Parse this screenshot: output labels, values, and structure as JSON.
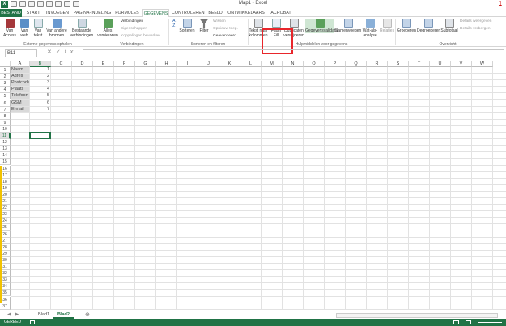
{
  "title": "Map1 - Excel",
  "tabs": [
    "BESTAND",
    "START",
    "INVOEGEN",
    "PAGINA-INDELING",
    "FORMULES",
    "GEGEVENS",
    "CONTROLEREN",
    "BEELD",
    "ONTWIKKELAARS",
    "ACROBAT"
  ],
  "ribbon": {
    "btn_access": "Van\nAccess",
    "btn_web": "Van\nweb",
    "btn_text": "Van\ntekst",
    "btn_other": "Van andere\nbronnen",
    "btn_existing": "Bestaande\nverbindingen",
    "btn_refresh": "Alles\nvernieuwen",
    "conn": "Verbindingen",
    "props": "Eigenschappen",
    "editlinks": "Koppelingen bewerken",
    "btn_sort": "Sorteren",
    "btn_filter": "Filter",
    "clear": "Wissen",
    "reapply": "Opnieuw toep.",
    "advanced": "Geavanceerd",
    "btn_t2c": "Tekst naar\nkolommen",
    "btn_flash": "Flash\nFill",
    "btn_dup": "Duplicaten\nverwijderen",
    "btn_valid": "Gegevensvalidatie",
    "btn_consol": "Samenvoegen",
    "btn_whatif": "Wat-als-\nanalyse",
    "btn_rel": "Relaties",
    "btn_group": "Groeperen",
    "btn_ungroup": "Degroeperen",
    "btn_subtotal": "Subtotaal",
    "showdetail": "Details weergeven",
    "hidedetail": "Details verbergen",
    "g_external": "Externe gegevens ophalen",
    "g_conn": "Verbindingen",
    "g_sort": "Sorteren en filteren",
    "g_tools": "Hulpmiddelen voor gegevens",
    "g_outline": "Overzicht"
  },
  "namebox": "B11",
  "fx_label": "fx",
  "columns": [
    "A",
    "B",
    "C",
    "D",
    "E",
    "F",
    "G",
    "H",
    "I",
    "J",
    "K",
    "L",
    "M",
    "N",
    "O",
    "P",
    "Q",
    "R",
    "S",
    "T",
    "U",
    "V",
    "W"
  ],
  "rows": [
    "1",
    "2",
    "3",
    "4",
    "5",
    "6",
    "7",
    "8",
    "9",
    "10",
    "11",
    "12",
    "13",
    "14",
    "15",
    "16",
    "17",
    "18",
    "19",
    "20",
    "21",
    "22",
    "23",
    "24",
    "25",
    "26",
    "27",
    "28",
    "29",
    "30",
    "31",
    "32",
    "33",
    "34",
    "35",
    "36",
    "37"
  ],
  "cells": [
    {
      "a": "Naam",
      "b": "1"
    },
    {
      "a": "Adres",
      "b": "2"
    },
    {
      "a": "Postcode",
      "b": "3"
    },
    {
      "a": "Plaats",
      "b": "4"
    },
    {
      "a": "Telefoon",
      "b": "5"
    },
    {
      "a": "GSM",
      "b": "6"
    },
    {
      "a": "E-mail",
      "b": "7"
    }
  ],
  "sheets": [
    "Blad1",
    "Blad2"
  ],
  "active_sheet": "Blad2",
  "status": "GEREED",
  "accent": "#217346"
}
